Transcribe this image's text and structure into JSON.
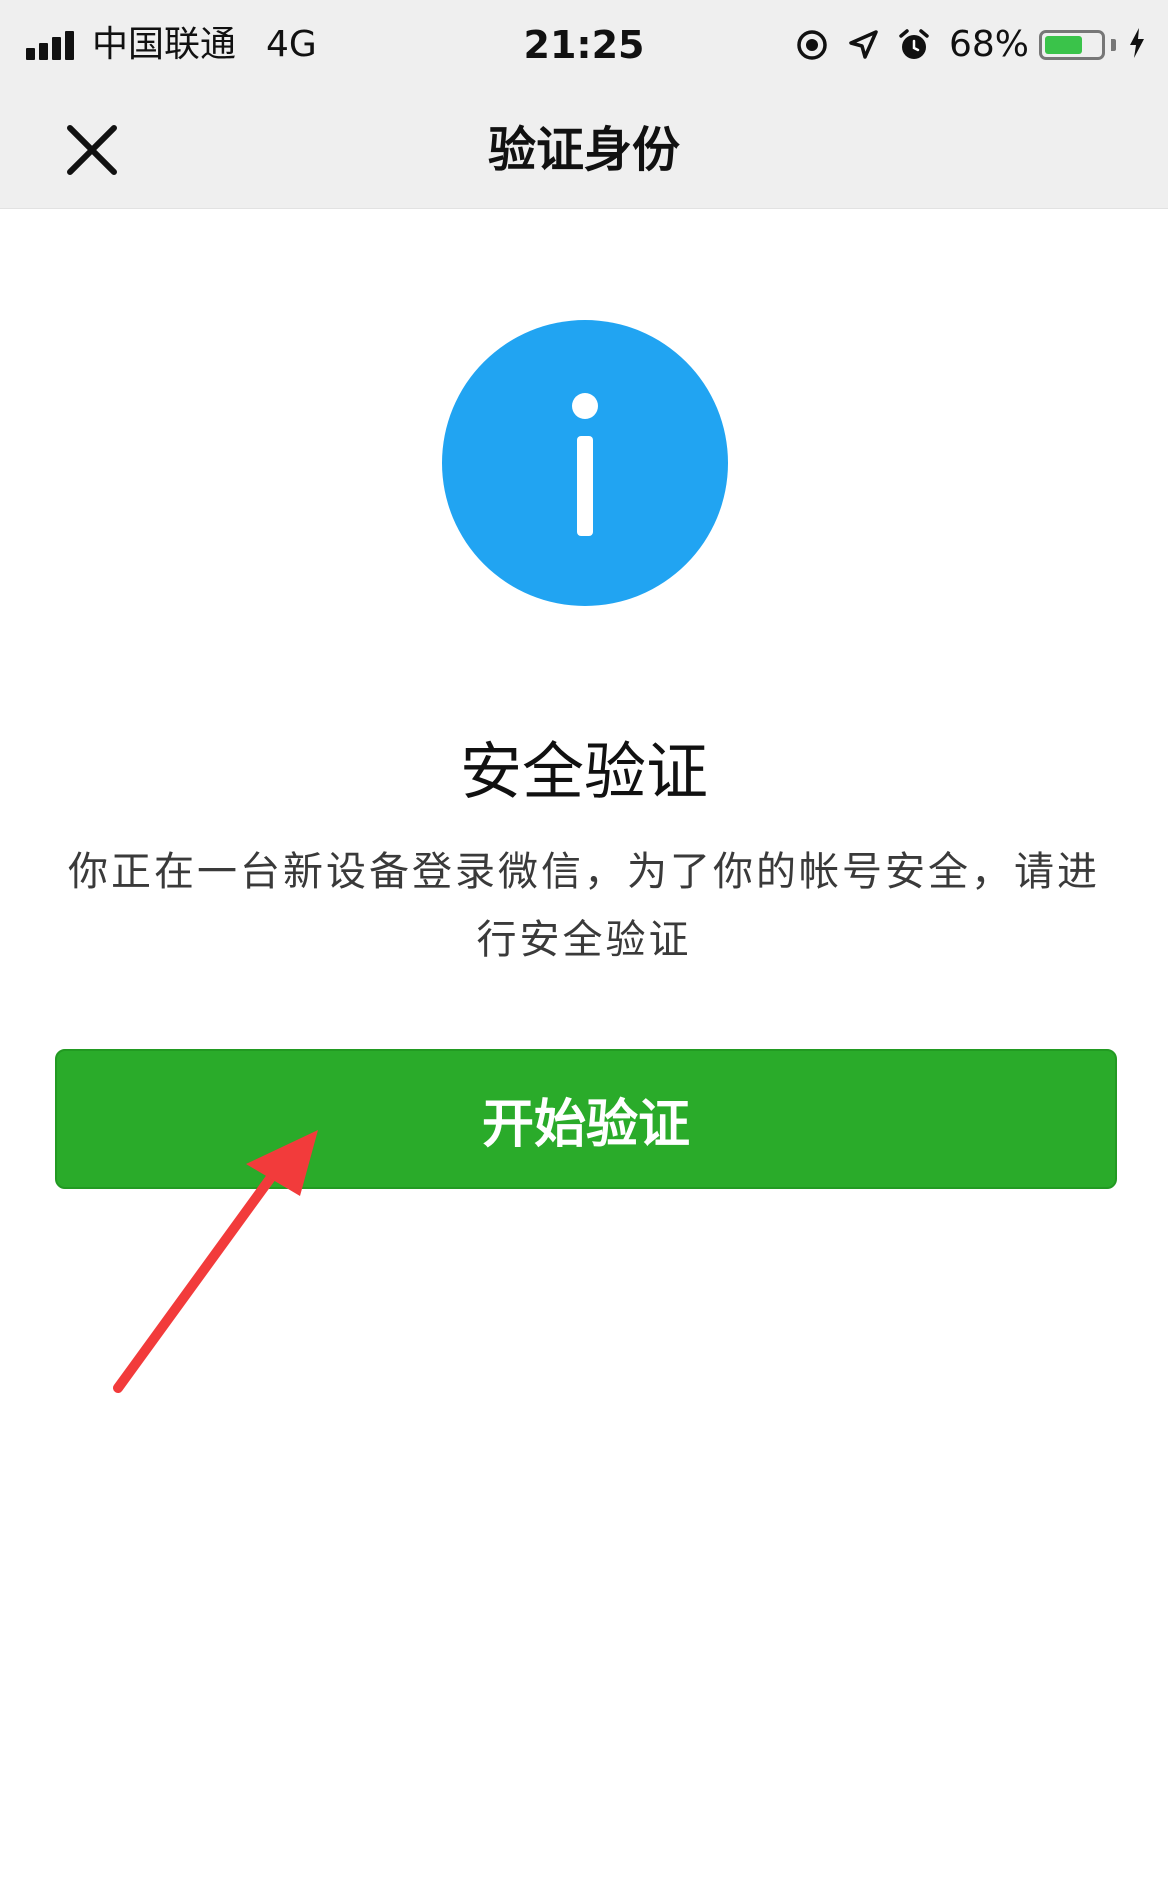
{
  "status_bar": {
    "carrier": "中国联通",
    "network": "4G",
    "time": "21:25",
    "battery_percent": "68%",
    "battery_level": 0.68,
    "icons": [
      "signal-icon",
      "screen-lock-icon",
      "location-icon",
      "alarm-icon",
      "battery-icon",
      "charging-icon"
    ]
  },
  "nav": {
    "title": "验证身份",
    "close_icon": "close-icon"
  },
  "main": {
    "icon": "info-icon",
    "heading": "安全验证",
    "description": "你正在一台新设备登录微信，为了你的帐号安全，请进行安全验证",
    "button_label": "开始验证"
  },
  "colors": {
    "accent_blue": "#21a4f2",
    "button_green": "#2aab2a",
    "annotation_red": "#f23b3b",
    "bar_background": "#efefef"
  }
}
